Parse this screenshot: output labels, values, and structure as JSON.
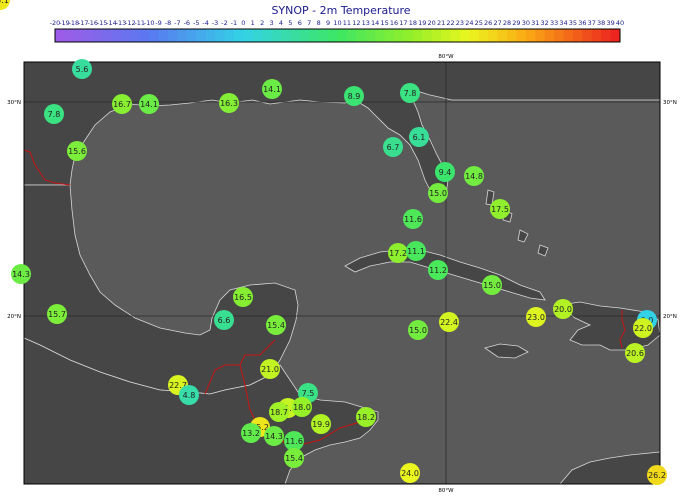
{
  "title": "SYNOP - 2m Temperature",
  "colorbar": {
    "ticks": [
      "-20",
      "-19",
      "-18",
      "-17",
      "-16",
      "-15",
      "-14",
      "-13",
      "-12",
      "-11",
      "-10",
      "-9",
      "-8",
      "-7",
      "-6",
      "-5",
      "-4",
      "-3",
      "-2",
      "-1",
      "0",
      "1",
      "2",
      "3",
      "4",
      "5",
      "6",
      "7",
      "8",
      "9",
      "10",
      "11",
      "12",
      "13",
      "14",
      "15",
      "16",
      "17",
      "18",
      "19",
      "20",
      "21",
      "22",
      "23",
      "24",
      "25",
      "26",
      "27",
      "28",
      "29",
      "30",
      "31",
      "32",
      "33",
      "34",
      "35",
      "36",
      "37",
      "38",
      "39",
      "40"
    ],
    "min": -20,
    "max": 40
  },
  "axes": {
    "top_lon": "80°W",
    "bottom_lon": "80°W",
    "left_lat_30": "30°N",
    "left_lat_20": "20°N",
    "right_lat_30": "30°N",
    "right_lat_20": "20°N"
  },
  "colors": {
    "ocean": "#5a5a5a",
    "land": "#464646",
    "coast": "#d8d8d8",
    "border": "#c81414",
    "grid": "#2a2a2a"
  },
  "stations": [
    {
      "label": "5.6",
      "value": 5.6
    },
    {
      "label": "7.8",
      "value": 7.8
    },
    {
      "label": "16.7",
      "value": 16.7
    },
    {
      "label": "14.1",
      "value": 14.1
    },
    {
      "label": "16.3",
      "value": 16.3
    },
    {
      "label": "14.1",
      "value": 14.1
    },
    {
      "label": "8.9",
      "value": 8.9
    },
    {
      "label": "7.8",
      "value": 7.8
    },
    {
      "label": "15.6",
      "value": 15.6
    },
    {
      "label": "6.1",
      "value": 6.1
    },
    {
      "label": "6.7",
      "value": 6.7
    },
    {
      "label": "9.4",
      "value": 9.4
    },
    {
      "label": "14.8",
      "value": 14.8
    },
    {
      "label": "15.0",
      "value": 15.0
    },
    {
      "label": "11.6",
      "value": 11.6
    },
    {
      "label": "17.5",
      "value": 17.5
    },
    {
      "label": "17.2",
      "value": 17.2
    },
    {
      "label": "11.1",
      "value": 11.1
    },
    {
      "label": "14.3",
      "value": 14.3
    },
    {
      "label": "11.2",
      "value": 11.2
    },
    {
      "label": "15.0",
      "value": 15.0
    },
    {
      "label": "16.5",
      "value": 16.5
    },
    {
      "label": "15.7",
      "value": 15.7
    },
    {
      "label": "6.6",
      "value": 6.6
    },
    {
      "label": "15.4",
      "value": 15.4
    },
    {
      "label": "15.0",
      "value": 15.0
    },
    {
      "label": "22.4",
      "value": 22.4
    },
    {
      "label": "23.0",
      "value": 23.0
    },
    {
      "label": "20.0",
      "value": 20.0
    },
    {
      "label": "0.0",
      "value": 0.0
    },
    {
      "label": "22.0",
      "value": 22.0
    },
    {
      "label": "20.6",
      "value": 20.6
    },
    {
      "label": "21.0",
      "value": 21.0
    },
    {
      "label": "22.7",
      "value": 22.7
    },
    {
      "label": "4.8",
      "value": 4.8
    },
    {
      "label": "7.5",
      "value": 7.5
    },
    {
      "label": "21.3",
      "value": 21.3
    },
    {
      "label": "18.0",
      "value": 18.0
    },
    {
      "label": "18.7",
      "value": 18.7
    },
    {
      "label": "19.9",
      "value": 19.9
    },
    {
      "label": "18.2",
      "value": 18.2
    },
    {
      "label": "25.2",
      "value": 25.2
    },
    {
      "label": "13.2",
      "value": 13.2
    },
    {
      "label": "14.3",
      "value": 14.3
    },
    {
      "label": "11.6",
      "value": 11.6
    },
    {
      "label": "15.4",
      "value": 15.4
    },
    {
      "label": "24.0",
      "value": 24.0
    },
    {
      "label": "26.2",
      "value": 26.2
    },
    {
      "label": "25.1",
      "value": 25.1
    }
  ]
}
